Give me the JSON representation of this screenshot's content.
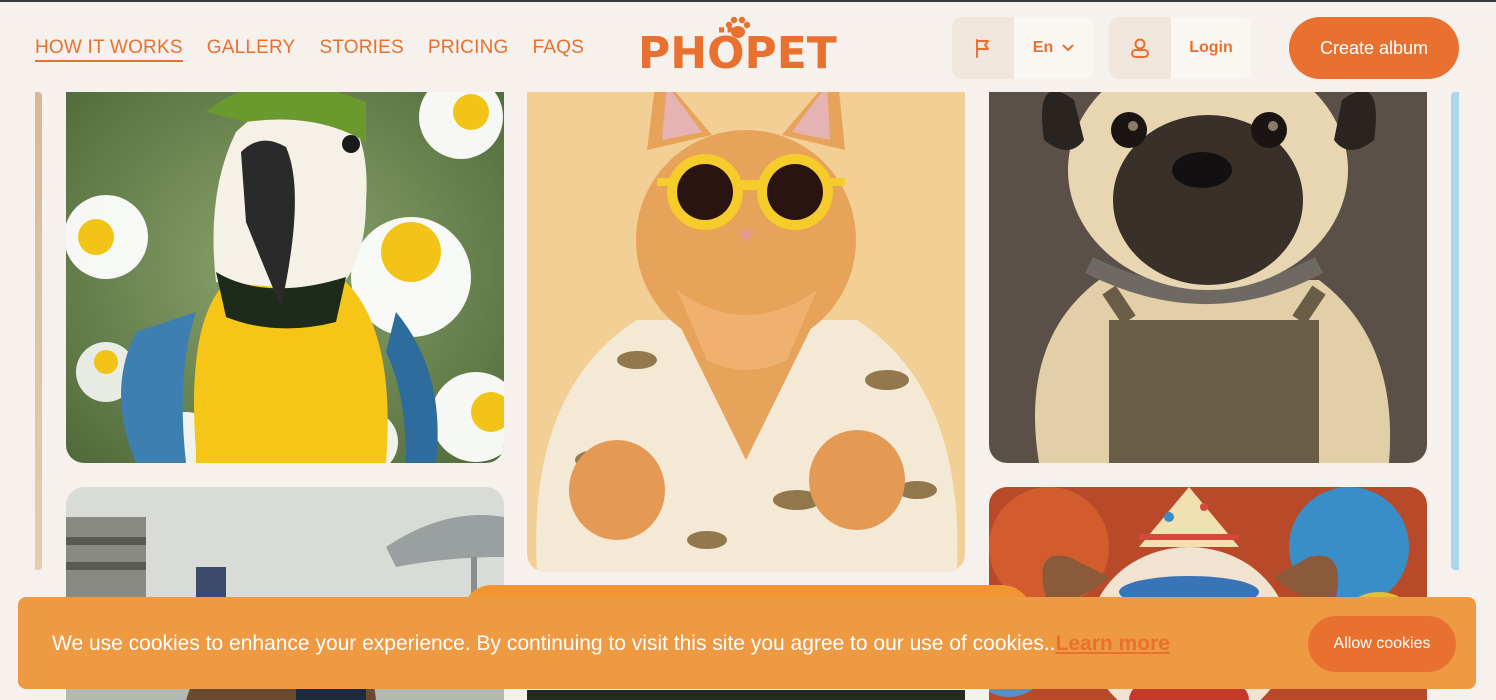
{
  "nav": {
    "items": [
      {
        "label": "HOW IT WORKS",
        "active": true
      },
      {
        "label": "GALLERY"
      },
      {
        "label": "STORIES"
      },
      {
        "label": "PRICING"
      },
      {
        "label": "FAQS"
      }
    ]
  },
  "brand": {
    "logo_text": "PHÖPET",
    "logo_icon": "paw-icon"
  },
  "header": {
    "language": "En",
    "language_icon": "flag-icon",
    "login_label": "Login",
    "login_icon": "user-icon",
    "create_album_label": "Create album"
  },
  "gallery": {
    "images": [
      {
        "name": "parrot-with-daisies"
      },
      {
        "name": "cat-with-sunglasses"
      },
      {
        "name": "pug-with-apron"
      },
      {
        "name": "dog-at-race-track"
      },
      {
        "name": "dog-with-party-hat"
      },
      {
        "name": "partial-image-bottom"
      }
    ]
  },
  "cookie_banner": {
    "text": "We use cookies to enhance your experience. By continuing to visit this site you agree to our use of cookies..",
    "link_label": "Learn more",
    "allow_label": "Allow cookies"
  },
  "colors": {
    "accent": "#e8712f",
    "background": "#f6f1ec",
    "cookie_bg": "#ee9a43"
  }
}
